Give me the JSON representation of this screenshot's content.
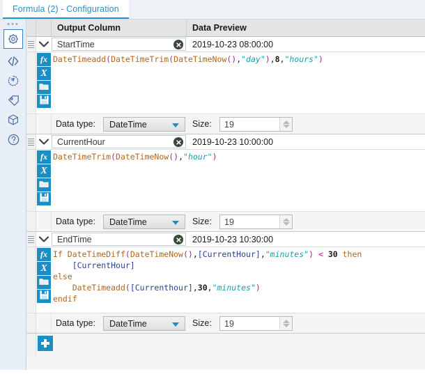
{
  "window": {
    "tab_label": "Formula (2) - Configuration"
  },
  "rail": {
    "overflow_dots": "•••",
    "items": [
      {
        "name": "gear-icon",
        "label": "Configuration",
        "selected": true
      },
      {
        "name": "code-icon",
        "label": "Annotation",
        "selected": false
      },
      {
        "name": "refresh-icon",
        "label": "Run",
        "selected": false
      },
      {
        "name": "tag-icon",
        "label": "Labels",
        "selected": false
      },
      {
        "name": "cube-icon",
        "label": "Package",
        "selected": false
      },
      {
        "name": "help-icon",
        "label": "Help",
        "selected": false
      }
    ]
  },
  "grid": {
    "columns": [
      {
        "key": "output_column",
        "label": "Output Column"
      },
      {
        "key": "data_preview",
        "label": "Data Preview"
      }
    ],
    "data_type_label": "Data type:",
    "size_label": "Size:",
    "add_button_label": "+"
  },
  "colors": {
    "accent": "#1b8fc4",
    "tab_text": "#2d8fc4",
    "function": "#b5651d",
    "paren": "#9b2d8f",
    "string": "#1c9fa8",
    "variable": "#2a3f8f",
    "operator": "#cf3fa8",
    "rail_bg": "#e8eef7"
  },
  "blocks": [
    {
      "id": "block-starttime",
      "output_column": "StartTime",
      "data_preview": "2019-10-23 08:00:00",
      "data_type": "DateTime",
      "size": "19",
      "formula_text": "DateTimeadd(DateTimeTrim(DateTimeNow(),\"day\"),8,\"hours\")",
      "formula_tokens": [
        [
          {
            "t": "DateTimeadd",
            "c": "fn"
          },
          {
            "t": "(",
            "c": "par"
          },
          {
            "t": "DateTimeTrim",
            "c": "fn"
          },
          {
            "t": "(",
            "c": "par"
          },
          {
            "t": "DateTimeNow",
            "c": "fn"
          },
          {
            "t": "(",
            "c": "par"
          },
          {
            "t": ")",
            "c": "par"
          },
          {
            "t": ",",
            "c": "com"
          },
          {
            "t": "\"day\"",
            "c": "str"
          },
          {
            "t": ")",
            "c": "par"
          },
          {
            "t": ",",
            "c": "com"
          },
          {
            "t": "8",
            "c": "num"
          },
          {
            "t": ",",
            "c": "com"
          },
          {
            "t": "\"hours\"",
            "c": "str"
          },
          {
            "t": ")",
            "c": "par"
          }
        ]
      ],
      "toolbar": [
        {
          "name": "insert-function-button",
          "glyph": "fx"
        },
        {
          "name": "insert-variable-button",
          "glyph": "X"
        },
        {
          "name": "open-formula-button",
          "glyph": "folder"
        },
        {
          "name": "save-formula-button",
          "glyph": "save"
        }
      ]
    },
    {
      "id": "block-currenthour",
      "output_column": "CurrentHour",
      "data_preview": "2019-10-23 10:00:00",
      "data_type": "DateTime",
      "size": "19",
      "formula_text": "DateTimeTrim(DateTimeNow(),\"hour\")",
      "formula_tokens": [
        [
          {
            "t": "DateTimeTrim",
            "c": "fn"
          },
          {
            "t": "(",
            "c": "par"
          },
          {
            "t": "DateTimeNow",
            "c": "fn"
          },
          {
            "t": "(",
            "c": "par"
          },
          {
            "t": ")",
            "c": "par"
          },
          {
            "t": ",",
            "c": "com"
          },
          {
            "t": "\"hour\"",
            "c": "str"
          },
          {
            "t": ")",
            "c": "par"
          }
        ]
      ],
      "toolbar": [
        {
          "name": "insert-function-button",
          "glyph": "fx"
        },
        {
          "name": "insert-variable-button",
          "glyph": "X"
        },
        {
          "name": "open-formula-button",
          "glyph": "folder"
        },
        {
          "name": "save-formula-button",
          "glyph": "save"
        }
      ]
    },
    {
      "id": "block-endtime",
      "output_column": "EndTime",
      "data_preview": "2019-10-23 10:30:00",
      "data_type": "DateTime",
      "size": "19",
      "formula_text": "If DateTimeDiff(DateTimeNow(),[CurrentHour],\"minutes\") < 30 then\n    [CurrentHour]\nelse\n    DateTimeadd([Currenthour],30,\"minutes\")\nendif",
      "formula_tokens": [
        [
          {
            "t": "If ",
            "c": "kw"
          },
          {
            "t": "DateTimeDiff",
            "c": "fn"
          },
          {
            "t": "(",
            "c": "par"
          },
          {
            "t": "DateTimeNow",
            "c": "fn"
          },
          {
            "t": "(",
            "c": "par"
          },
          {
            "t": ")",
            "c": "par"
          },
          {
            "t": ",",
            "c": "com"
          },
          {
            "t": "[CurrentHour]",
            "c": "var"
          },
          {
            "t": ",",
            "c": "com"
          },
          {
            "t": "\"minutes\"",
            "c": "str"
          },
          {
            "t": ")",
            "c": "par"
          },
          {
            "t": " ",
            "c": "com"
          },
          {
            "t": "<",
            "c": "op"
          },
          {
            "t": " ",
            "c": "com"
          },
          {
            "t": "30",
            "c": "num"
          },
          {
            "t": " ",
            "c": "com"
          },
          {
            "t": "then",
            "c": "kw"
          }
        ],
        [
          {
            "t": "    ",
            "c": "com"
          },
          {
            "t": "[CurrentHour]",
            "c": "var"
          }
        ],
        [
          {
            "t": "else",
            "c": "kw"
          }
        ],
        [
          {
            "t": "    ",
            "c": "com"
          },
          {
            "t": "DateTimeadd",
            "c": "fn"
          },
          {
            "t": "(",
            "c": "par"
          },
          {
            "t": "[Currenthour]",
            "c": "var"
          },
          {
            "t": ",",
            "c": "com"
          },
          {
            "t": "30",
            "c": "num"
          },
          {
            "t": ",",
            "c": "com"
          },
          {
            "t": "\"minutes\"",
            "c": "str"
          },
          {
            "t": ")",
            "c": "par"
          }
        ],
        [
          {
            "t": "endif",
            "c": "kw"
          }
        ]
      ],
      "toolbar": [
        {
          "name": "insert-function-button",
          "glyph": "fx"
        },
        {
          "name": "insert-variable-button",
          "glyph": "X"
        },
        {
          "name": "open-formula-button",
          "glyph": "folder"
        },
        {
          "name": "save-formula-button",
          "glyph": "save"
        }
      ]
    }
  ]
}
